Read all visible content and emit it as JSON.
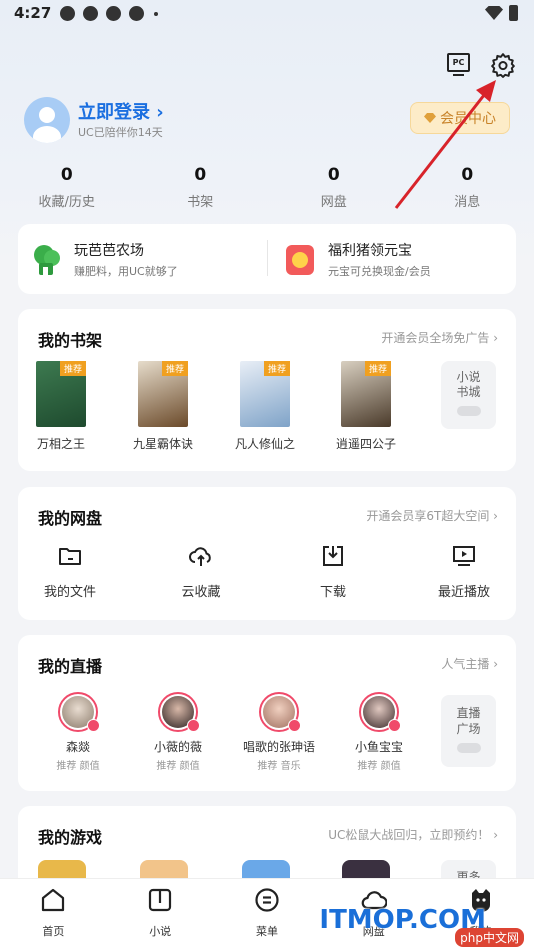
{
  "status_bar": {
    "time": "4:27"
  },
  "header": {
    "pc_label": "PC"
  },
  "user": {
    "login_label": "立即登录",
    "login_chevron": "›",
    "subtitle": "UC已陪伴你14天",
    "vip_label": "会员中心"
  },
  "stats": [
    {
      "value": "0",
      "label": "收藏/历史"
    },
    {
      "value": "0",
      "label": "书架"
    },
    {
      "value": "0",
      "label": "网盘"
    },
    {
      "value": "0",
      "label": "消息"
    }
  ],
  "promo": [
    {
      "title": "玩芭芭农场",
      "subtitle": "赚肥料，用UC就够了"
    },
    {
      "title": "福利猪领元宝",
      "subtitle": "元宝可兑换现金/会员"
    }
  ],
  "shelf": {
    "title": "我的书架",
    "link": "开通会员全场免广告 ›",
    "books": [
      {
        "name": "万相之王",
        "tag": "推荐",
        "cover_color": "#2a5a3a"
      },
      {
        "name": "九星霸体诀",
        "tag": "推荐",
        "cover_color": "#6b4a2a"
      },
      {
        "name": "凡人修仙之",
        "tag": "推荐",
        "cover_color": "#7fa3c8"
      },
      {
        "name": "逍遥四公子",
        "tag": "推荐",
        "cover_color": "#5a4a3a"
      }
    ],
    "city_button": [
      "小说",
      "书城"
    ]
  },
  "disk": {
    "title": "我的网盘",
    "link": "开通会员享6T超大空间 ›",
    "items": [
      {
        "label": "我的文件",
        "icon": "folder-icon"
      },
      {
        "label": "云收藏",
        "icon": "cloud-upload-icon"
      },
      {
        "label": "下载",
        "icon": "download-icon"
      },
      {
        "label": "最近播放",
        "icon": "play-icon"
      }
    ]
  },
  "live": {
    "title": "我的直播",
    "link": "人气主播 ›",
    "streamers": [
      {
        "name": "森燚",
        "tags": "推荐 颜值",
        "face_color": "#b8a898"
      },
      {
        "name": "小薇的薇",
        "tags": "推荐 颜值",
        "face_color": "#3a3030"
      },
      {
        "name": "唱歌的张珅语",
        "tags": "推荐 音乐",
        "face_color": "#c89a80"
      },
      {
        "name": "小鱼宝宝",
        "tags": "推荐 颜值",
        "face_color": "#4a3a3a"
      }
    ],
    "plaza_button": [
      "直播",
      "广场"
    ]
  },
  "games": {
    "title": "我的游戏",
    "link": "UC松鼠大战回归，立即预约！ ›",
    "thumb_colors": [
      "#e8b84a",
      "#f2c48a",
      "#6aa8e8",
      "#3a3040"
    ],
    "more_label": "更多"
  },
  "bottom_nav": [
    {
      "label": "首页",
      "icon": "home-icon"
    },
    {
      "label": "小说",
      "icon": "book-icon"
    },
    {
      "label": "菜单",
      "icon": "menu-icon"
    },
    {
      "label": "网盘",
      "icon": "cloud-icon"
    },
    {
      "label": "我的",
      "icon": "profile-icon"
    }
  ],
  "watermark": {
    "text": "ITMOP.COM",
    "badge": "php中文网"
  },
  "colors": {
    "accent": "#1b6fe0",
    "vip_text": "#c8832a",
    "live_ring": "#f04a6a",
    "annotation_arrow": "#d8232a"
  }
}
